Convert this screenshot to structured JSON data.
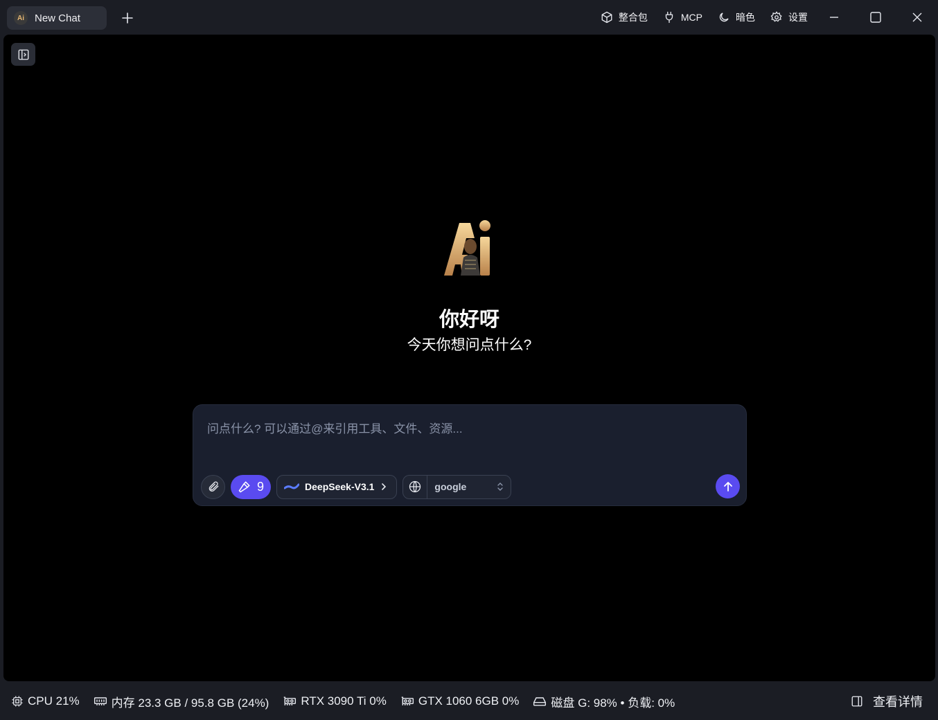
{
  "tab": {
    "title": "New Chat",
    "logo_text": "Ai"
  },
  "top_actions": {
    "bundle_label": "整合包",
    "mcp_label": "MCP",
    "theme_label": "暗色",
    "settings_label": "设置"
  },
  "hero": {
    "logo_text": "Ai",
    "greeting": "你好呀",
    "subgreeting": "今天你想问点什么?"
  },
  "composer": {
    "placeholder": "问点什么? 可以通过@来引用工具、文件、资源...",
    "value": "",
    "tools_count": "9",
    "model_name": "DeepSeek-V3.1",
    "search_engine": "google"
  },
  "status": {
    "cpu": "CPU 21%",
    "memory": "内存 23.3 GB / 95.8 GB (24%)",
    "gpu1": "RTX 3090 Ti 0%",
    "gpu2": "GTX 1060 6GB 0%",
    "disk": "磁盘 G: 98% • 负载: 0%",
    "details_label": "查看详情"
  },
  "colors": {
    "accent": "#5a4bf0",
    "background": "#000000",
    "chrome": "#1b1d24",
    "composer": "#1a1f2e"
  }
}
